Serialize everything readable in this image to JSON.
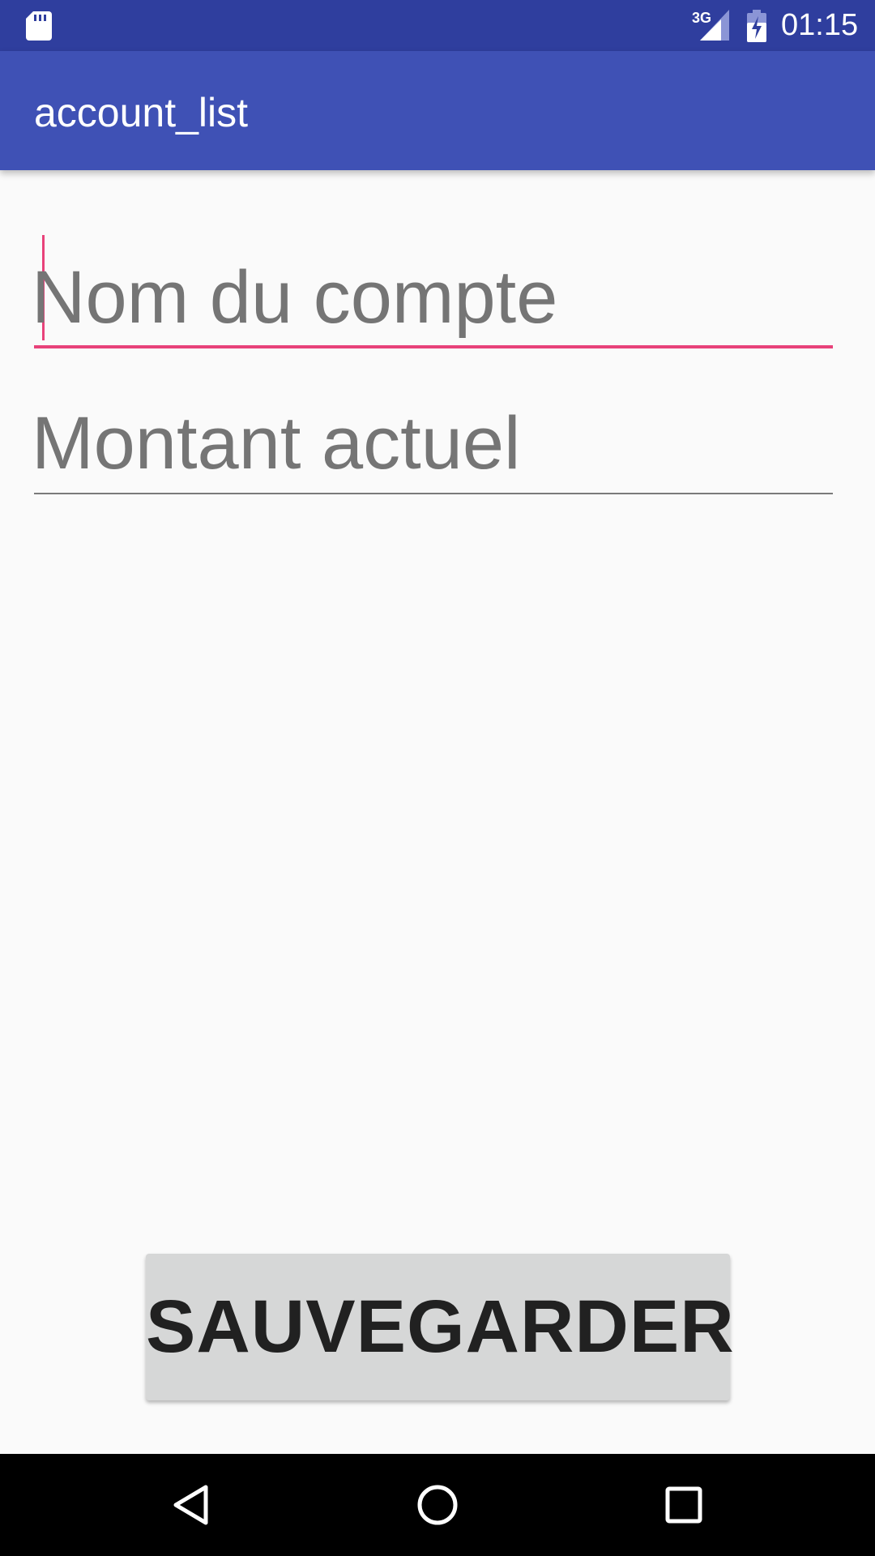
{
  "status_bar": {
    "network_type": "3G",
    "time": "01:15",
    "icons": [
      "sd-card-icon",
      "signal-icon",
      "battery-charging-icon"
    ]
  },
  "app_bar": {
    "title": "account_list"
  },
  "form": {
    "account_name": {
      "placeholder": "Nom du compte",
      "value": ""
    },
    "current_amount": {
      "placeholder": "Montant actuel",
      "value": ""
    },
    "save_label": "SAUVEGARDER"
  },
  "nav_bar": {
    "icons": [
      "back-icon",
      "home-icon",
      "recents-icon"
    ]
  },
  "colors": {
    "status_bar": "#2f3e9e",
    "app_bar": "#3f51b5",
    "accent": "#e8427a",
    "background": "#fafafa",
    "button": "#d6d7d7"
  }
}
